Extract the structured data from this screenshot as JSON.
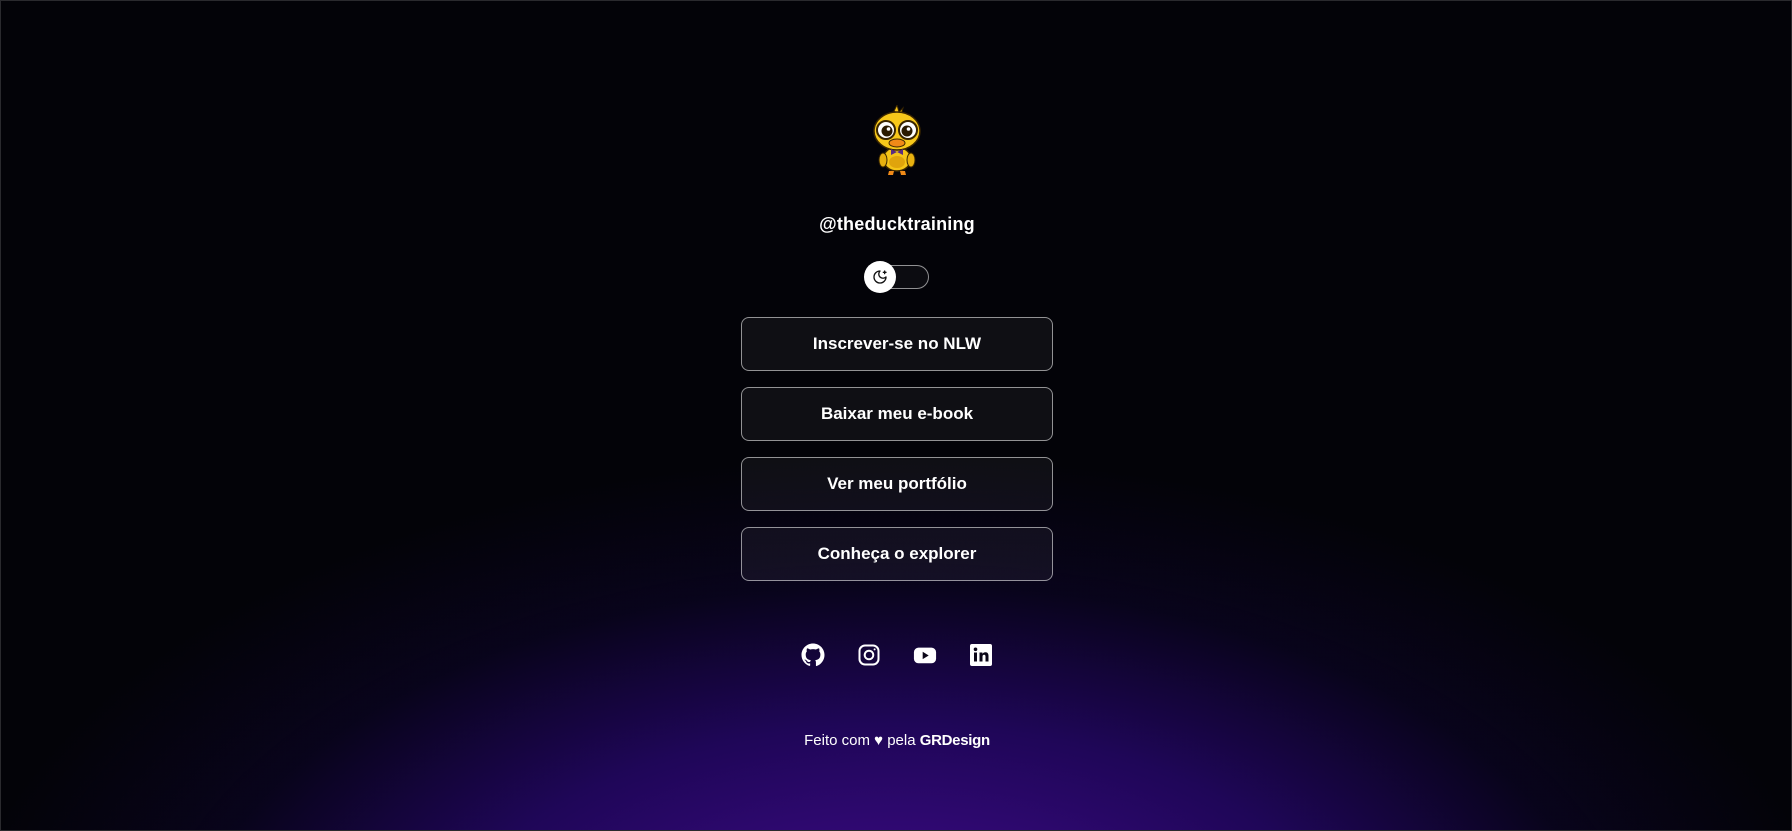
{
  "profile": {
    "username": "@theducktraining",
    "avatar_icon": "duck-mascot-icon"
  },
  "theme_switch": {
    "icon": "moon-icon",
    "state": "dark"
  },
  "links": [
    {
      "label": "Inscrever-se no NLW"
    },
    {
      "label": "Baixar meu e-book"
    },
    {
      "label": "Ver meu portfólio"
    },
    {
      "label": "Conheça o explorer"
    }
  ],
  "socials": [
    {
      "icon": "github-icon"
    },
    {
      "icon": "instagram-icon"
    },
    {
      "icon": "youtube-icon"
    },
    {
      "icon": "linkedin-icon"
    }
  ],
  "footer": {
    "prefix": "Feito com",
    "heart": "♥",
    "middle": "pela",
    "brand": "GRDesign"
  },
  "colors": {
    "background_top": "#030308",
    "background_glow": "#4a12a0",
    "text": "#ffffff",
    "avatar_yellow": "#f5c518"
  }
}
